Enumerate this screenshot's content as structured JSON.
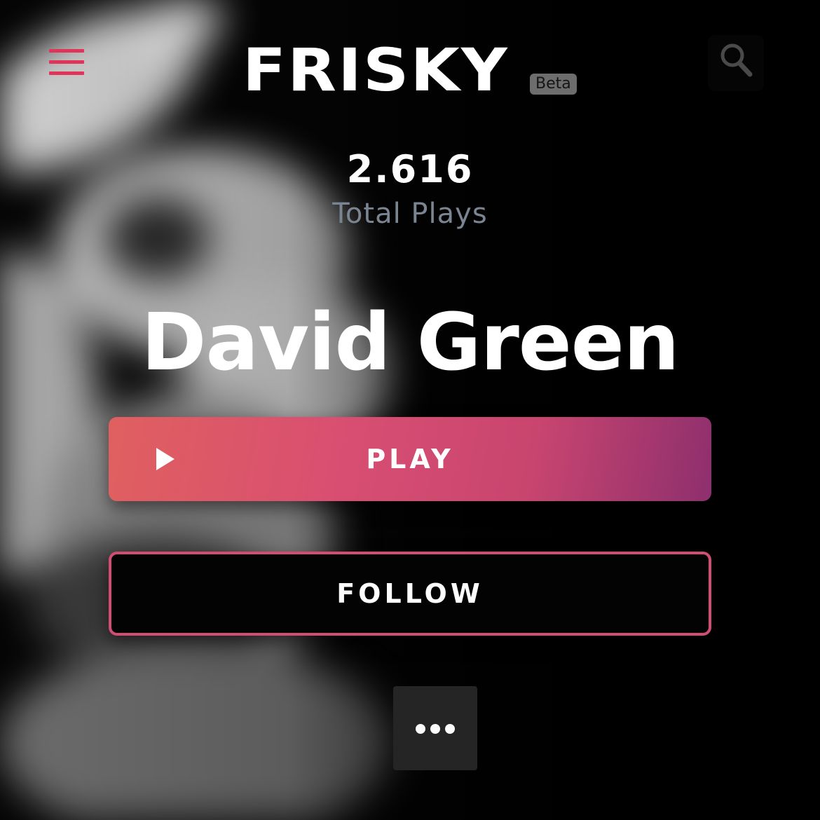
{
  "header": {
    "logo_text": "FRISKY",
    "beta_badge": "Beta",
    "menu_icon": "hamburger-menu-icon",
    "search_icon": "search-icon"
  },
  "stats": {
    "total_plays_value": "2.616",
    "total_plays_label": "Total Plays"
  },
  "artist": {
    "name": "David Green"
  },
  "actions": {
    "play_label": "PLAY",
    "play_icon": "play-icon",
    "follow_label": "FOLLOW",
    "more_icon": "more-dots-icon"
  },
  "colors": {
    "accent": "#e0345a",
    "play_gradient_start": "#e0605f",
    "play_gradient_end": "#8e2f6e",
    "follow_border": "#d24d73",
    "muted_text": "#7a8591"
  }
}
